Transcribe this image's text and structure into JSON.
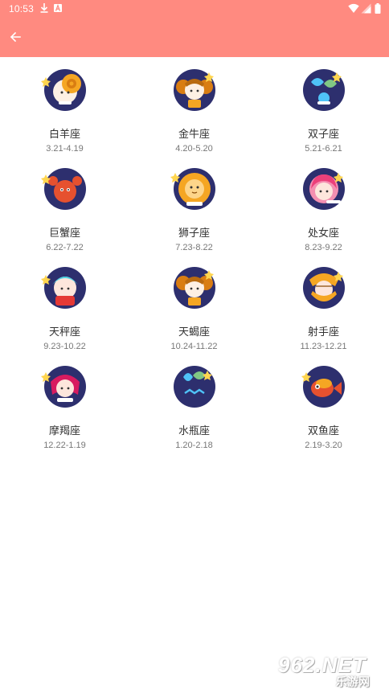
{
  "status_bar": {
    "time": "10:53",
    "icons": [
      "download-icon",
      "a-icon",
      "wifi-icon",
      "signal-icon",
      "battery-icon"
    ]
  },
  "app_bar": {
    "back_icon": "arrow-left-icon",
    "color": "#ff8a80"
  },
  "zodiac": [
    {
      "name": "白羊座",
      "dates": "3.21-4.19",
      "icon": "aries-icon"
    },
    {
      "name": "金牛座",
      "dates": "4.20-5.20",
      "icon": "taurus-icon"
    },
    {
      "name": "双子座",
      "dates": "5.21-6.21",
      "icon": "gemini-icon"
    },
    {
      "name": "巨蟹座",
      "dates": "6.22-7.22",
      "icon": "cancer-icon"
    },
    {
      "name": "狮子座",
      "dates": "7.23-8.22",
      "icon": "leo-icon"
    },
    {
      "name": "处女座",
      "dates": "8.23-9.22",
      "icon": "virgo-icon"
    },
    {
      "name": "天秤座",
      "dates": "9.23-10.22",
      "icon": "libra-icon"
    },
    {
      "name": "天蝎座",
      "dates": "10.24-11.22",
      "icon": "scorpio-icon"
    },
    {
      "name": "射手座",
      "dates": "11.23-12.21",
      "icon": "sagittarius-icon"
    },
    {
      "name": "摩羯座",
      "dates": "12.22-1.19",
      "icon": "capricorn-icon"
    },
    {
      "name": "水瓶座",
      "dates": "1.20-2.18",
      "icon": "aquarius-icon"
    },
    {
      "name": "双鱼座",
      "dates": "2.19-3.20",
      "icon": "pisces-icon"
    }
  ],
  "watermark": {
    "top": "962.NET",
    "bottom": "乐游网"
  }
}
